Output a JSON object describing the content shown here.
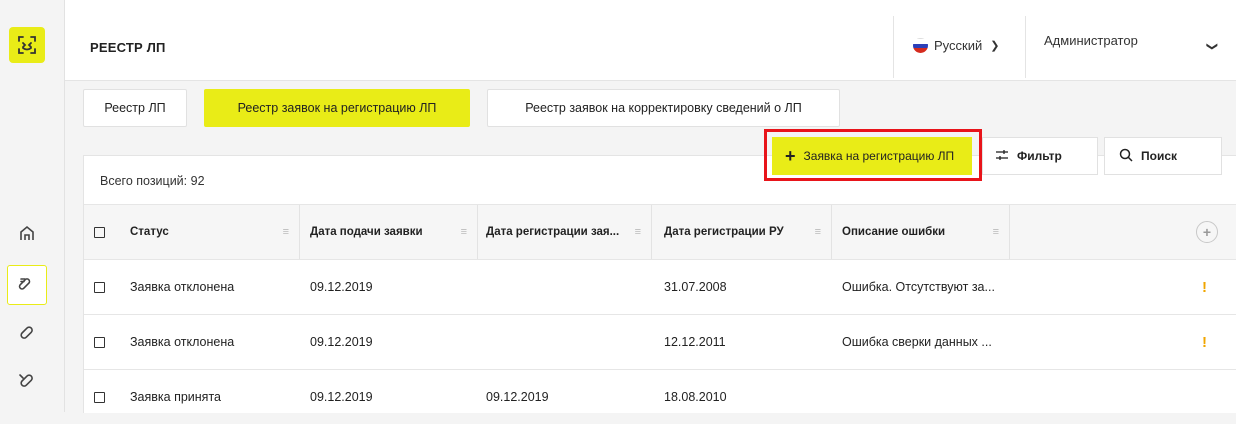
{
  "header": {
    "title": "РЕЕСТР ЛП",
    "language": "Русский",
    "user": "Администратор"
  },
  "tabs": [
    {
      "label": "Реестр ЛП",
      "active": false
    },
    {
      "label": "Реестр заявок на регистрацию ЛП",
      "active": true
    },
    {
      "label": "Реестр заявок на корректировку сведений о ЛП",
      "active": false
    }
  ],
  "actions": {
    "new_request": "Заявка на регистрацию ЛП",
    "filter": "Фильтр",
    "search": "Поиск"
  },
  "table": {
    "total": "Всего позиций: 92",
    "columns": [
      "Статус",
      "Дата подачи заявки",
      "Дата регистрации зая...",
      "Дата регистрации РУ",
      "Описание ошибки"
    ],
    "rows": [
      {
        "status": "Заявка отклонена",
        "submitted": "09.12.2019",
        "registered": "",
        "ru_date": "31.07.2008",
        "error": "Ошибка. Отсутствуют за...",
        "warning": true
      },
      {
        "status": "Заявка отклонена",
        "submitted": "09.12.2019",
        "registered": "",
        "ru_date": "12.12.2011",
        "error": "Ошибка сверки данных ...",
        "warning": true
      },
      {
        "status": "Заявка принята",
        "submitted": "09.12.2019",
        "registered": "09.12.2019",
        "ru_date": "18.08.2010",
        "error": "",
        "warning": false
      }
    ]
  },
  "colors": {
    "accent": "#e9ec17",
    "highlight": "#e8141a",
    "warning": "#f0a500"
  }
}
